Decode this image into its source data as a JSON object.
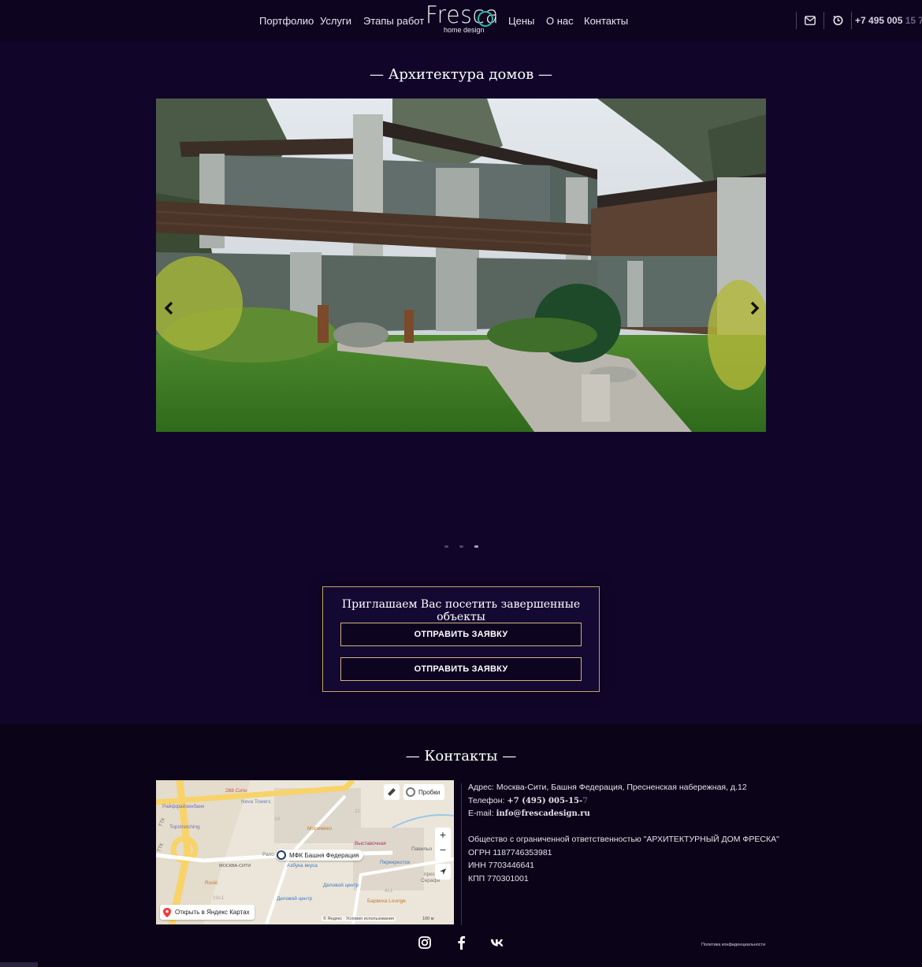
{
  "header": {
    "nav_left": [
      "Портфолио",
      "Услуги",
      "Этапы работ"
    ],
    "nav_right": [
      "Цены",
      "О нас",
      "Контакты"
    ],
    "logo_text": "Fresca",
    "logo_subtitle": "home design",
    "phone_main": "+7 495 005 ",
    "phone_faded": "15 7",
    "icons": [
      "mail-icon",
      "clock-phone-icon"
    ]
  },
  "gallery": {
    "title": "— Архитектура домов —",
    "image_alt": "Modern country house with wood and concrete facade and landscaped garden",
    "dots_count": 3,
    "active_dot": 3
  },
  "invite": {
    "title": "Приглашаем Вас посетить завершенные объекты",
    "button1": "ОТПРАВИТЬ ЗАЯВКУ",
    "button2": "ОТПРАВИТЬ ЗАЯВКУ"
  },
  "contacts": {
    "title": "— Контакты —",
    "address": "Адрес: Москва-Сити, Башня Федерация, Пресненская набережная, д.12",
    "phone_label": "Телефон: ",
    "phone_value": "+7 (495) 005-15-",
    "phone_faded": "7",
    "email_label": "E-mail: ",
    "email_value": "info@frescadesign.ru",
    "company": "Общество с ограниченной ответственностью \"АРХИТЕКТУРНЫЙ ДОМ ФРЕСКА\"",
    "ogrn": "ОГРН 1187746353981",
    "inn": "ИНН 7703446641",
    "kpp": "КПП 770301001"
  },
  "map": {
    "marker_label": "МФК Башня Федерация",
    "traffic_label": "Пробки",
    "open_label": "Открыть в Яндекс Картах",
    "copyright": "© Яндекс · Условия использования",
    "scale": "100 м",
    "labels": [
      "288 Сити",
      "Neva Towers",
      "Райффайзенбанк",
      "Topstretching",
      "Моремоко",
      "Выставочная",
      "Павильо",
      "Перекресток",
      "МОСКВА-СИТИ",
      "Азбука вкуса",
      "Ruski",
      "Деловой центр",
      "Деловой центр",
      "Барвиха Lounge",
      "ТТК",
      "ТТК",
      "Рапо",
      "прес",
      "Серафи",
      "19",
      "11",
      "10с1",
      "4с1"
    ]
  },
  "footer": {
    "social": [
      "instagram-icon",
      "facebook-icon",
      "vk-icon"
    ],
    "policy": "Политика конфиденциальности"
  }
}
